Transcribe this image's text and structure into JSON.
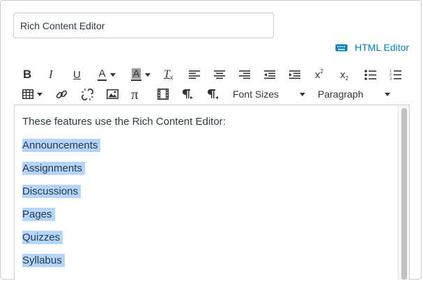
{
  "title_field": {
    "value": "Rich Content Editor"
  },
  "html_editor": {
    "label": "HTML Editor",
    "icon": "keyboard-icon"
  },
  "toolbar": {
    "bold": "B",
    "italic": "I",
    "underline": "U",
    "text_color": "A",
    "background_color": "A",
    "clear_format": "T",
    "superscript_base": "x",
    "superscript_mark": "2",
    "subscript_base": "x",
    "subscript_mark": "2",
    "math": "π",
    "font_sizes": "Font Sizes",
    "paragraph": "Paragraph"
  },
  "content": {
    "intro": "These features use the Rich Content Editor:",
    "items": [
      "Announcements",
      "Assignments",
      "Discussions",
      "Pages",
      "Quizzes",
      "Syllabus"
    ]
  },
  "colors": {
    "link": "#0081bd",
    "selection": "#b3d4fd",
    "border": "#c7cdd1"
  }
}
